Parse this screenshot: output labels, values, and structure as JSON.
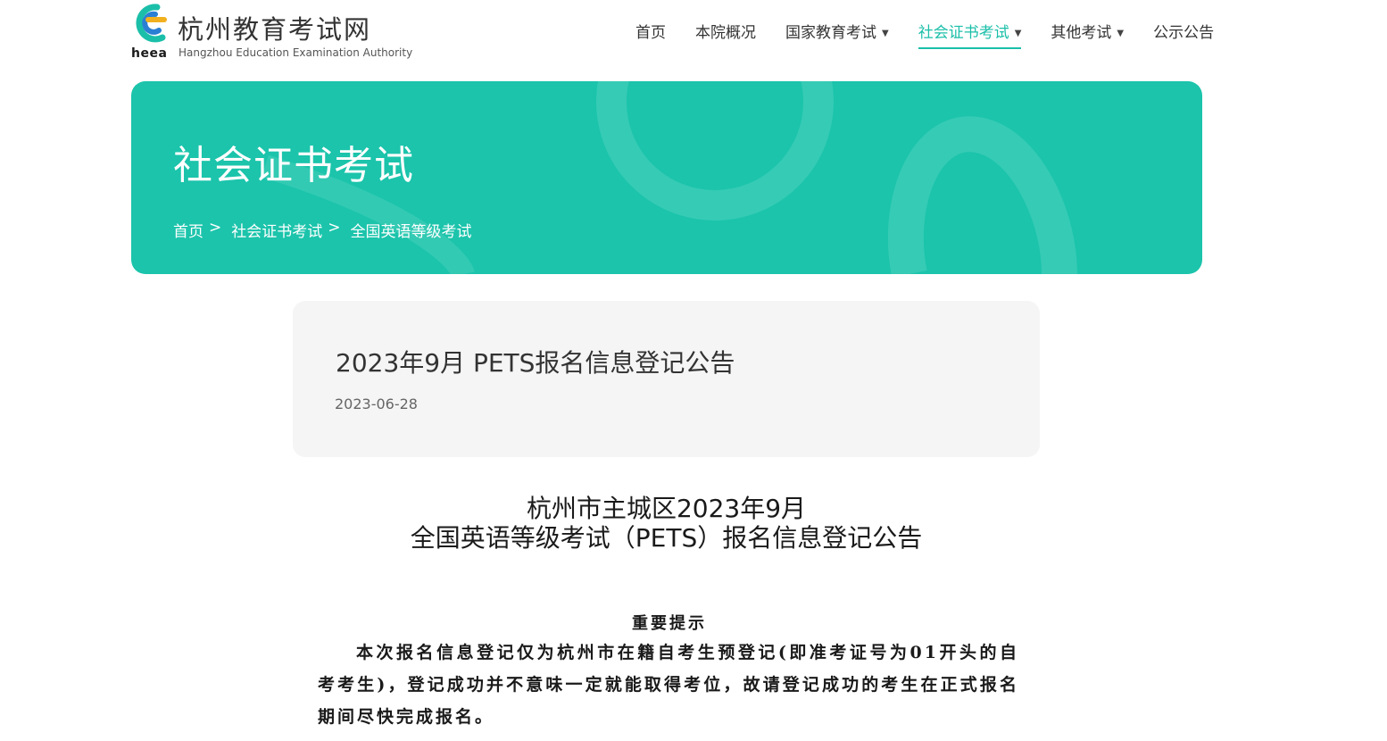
{
  "colors": {
    "accent": "#1bbfa9",
    "banner_bg": "#1bc4ab",
    "card_bg": "#f5f5f5"
  },
  "logo": {
    "abbr": "heea",
    "name_cn": "杭州教育考试网",
    "name_en": "Hangzhou Education Examination Authority"
  },
  "nav": {
    "items": [
      {
        "label": "首页",
        "has_dropdown": false,
        "active": false
      },
      {
        "label": "本院概况",
        "has_dropdown": false,
        "active": false
      },
      {
        "label": "国家教育考试",
        "has_dropdown": true,
        "active": false
      },
      {
        "label": "社会证书考试",
        "has_dropdown": true,
        "active": true
      },
      {
        "label": "其他考试",
        "has_dropdown": true,
        "active": false
      },
      {
        "label": "公示公告",
        "has_dropdown": false,
        "active": false
      }
    ],
    "caret_icon": "caret-down-icon"
  },
  "banner": {
    "title": "社会证书考试",
    "breadcrumb": [
      "首页",
      "社会证书考试",
      "全国英语等级考试"
    ],
    "separator": ">"
  },
  "article": {
    "title": "2023年9月 PETS报名信息登记公告",
    "date": "2023-06-28"
  },
  "content": {
    "heading_line1": "杭州市主城区2023年9月",
    "heading_line2": "全国英语等级考试（PETS）报名信息登记公告",
    "notice_label": "重要提示",
    "paragraph": "本次报名信息登记仅为杭州市在籍自考生预登记(即准考证号为01开头的自考考生)，登记成功并不意味一定就能取得考位，故请登记成功的考生在正式报名期间尽快完成报名。"
  }
}
